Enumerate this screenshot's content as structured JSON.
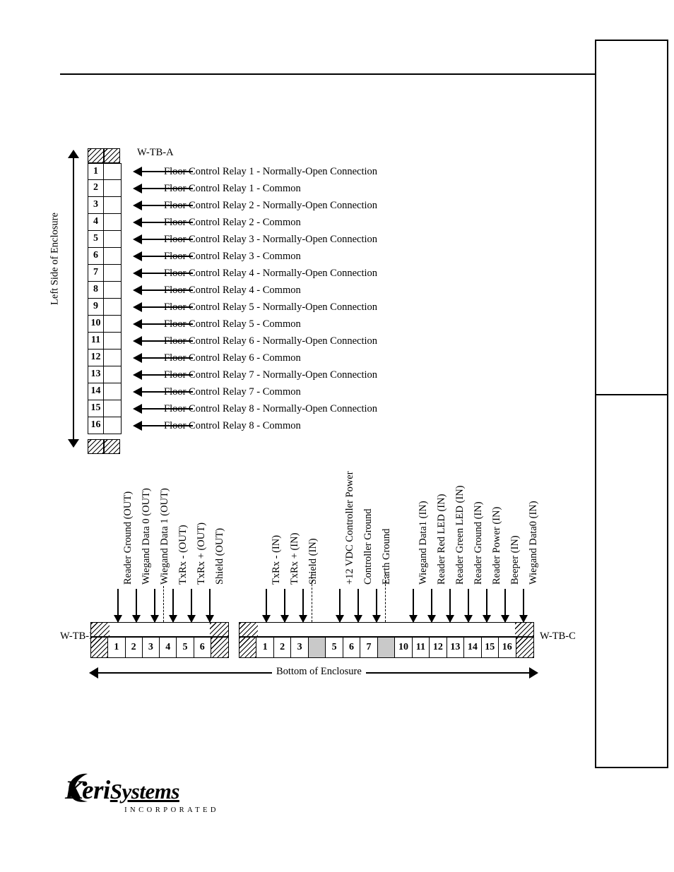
{
  "diagram": {
    "title_blocks": {
      "tb_a": "W-TB-A",
      "tb_b": "W-TB-B",
      "tb_c": "W-TB-C"
    },
    "left_axis_caption": "Left Side of Enclosure",
    "bottom_axis_caption": "Bottom of Enclosure",
    "tb_a_rows": [
      {
        "num": "1",
        "text": "Floor Control Relay 1 - Normally-Open Connection"
      },
      {
        "num": "2",
        "text": "Floor Control Relay 1 - Common"
      },
      {
        "num": "3",
        "text": "Floor Control Relay 2 - Normally-Open Connection"
      },
      {
        "num": "4",
        "text": "Floor Control Relay 2 - Common"
      },
      {
        "num": "5",
        "text": "Floor Control Relay 3 - Normally-Open Connection"
      },
      {
        "num": "6",
        "text": "Floor Control Relay 3 - Common"
      },
      {
        "num": "7",
        "text": "Floor Control Relay 4 - Normally-Open Connection"
      },
      {
        "num": "8",
        "text": "Floor Control Relay 4 - Common"
      },
      {
        "num": "9",
        "text": "Floor Control Relay 5 - Normally-Open Connection"
      },
      {
        "num": "10",
        "text": "Floor Control Relay 5 - Common"
      },
      {
        "num": "11",
        "text": "Floor Control Relay 6 - Normally-Open Connection"
      },
      {
        "num": "12",
        "text": "Floor Control Relay 6 - Common"
      },
      {
        "num": "13",
        "text": "Floor Control Relay 7 - Normally-Open Connection"
      },
      {
        "num": "14",
        "text": "Floor Control Relay 7 - Common"
      },
      {
        "num": "15",
        "text": "Floor Control Relay 8 - Normally-Open Connection"
      },
      {
        "num": "16",
        "text": "Floor Control Relay 8 - Common"
      }
    ],
    "tb_b_cells": [
      {
        "num": "1",
        "label": "Reader Ground (OUT)"
      },
      {
        "num": "2",
        "label": "Wiegand Data 0 (OUT)"
      },
      {
        "num": "3",
        "label": "Wiegand Data 1 (OUT)"
      },
      {
        "num": "4",
        "label": "TxRx - (OUT)"
      },
      {
        "num": "5",
        "label": "TxRx + (OUT)"
      },
      {
        "num": "6",
        "label": "Shield (OUT)"
      }
    ],
    "tb_c_cells": [
      {
        "num": "1",
        "label": "TxRx - (IN)"
      },
      {
        "num": "2",
        "label": "TxRx + (IN)"
      },
      {
        "num": "3",
        "label": "Shield (IN)"
      },
      {
        "num": "",
        "label": ""
      },
      {
        "num": "5",
        "label": "+12 VDC Controller Power"
      },
      {
        "num": "6",
        "label": "Controller Ground"
      },
      {
        "num": "7",
        "label": "Earth Ground"
      },
      {
        "num": "",
        "label": ""
      },
      {
        "num": "10",
        "label": "Wiegand Data1 (IN)"
      },
      {
        "num": "11",
        "label": "Reader Red LED (IN)"
      },
      {
        "num": "12",
        "label": "Reader Green LED (IN)"
      },
      {
        "num": "13",
        "label": "Reader Ground (IN)"
      },
      {
        "num": "14",
        "label": "Reader Power (IN)"
      },
      {
        "num": "15",
        "label": "Beeper (IN)"
      },
      {
        "num": "16",
        "label": "Wiegand Data0 (IN)"
      }
    ]
  },
  "logo": {
    "keri": "Keri",
    "systems": "Systems",
    "incorporated": "INCORPORATED"
  }
}
